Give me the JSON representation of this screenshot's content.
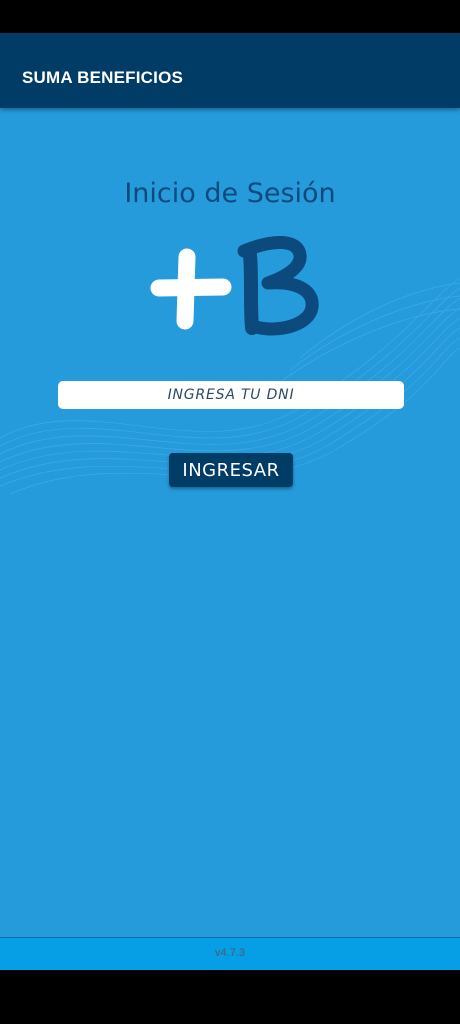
{
  "appbar": {
    "title": "SUMA BENEFICIOS"
  },
  "login": {
    "heading": "Inicio de Sesión",
    "dni_placeholder": "INGRESA TU DNI",
    "dni_value": "",
    "submit_label": "INGRESAR"
  },
  "logo": {
    "icon": "plus-b-logo"
  },
  "footer": {
    "version": "v4.7.3"
  },
  "colors": {
    "appbar": "#003c66",
    "background": "#259bdc",
    "heading": "#0e4a7e",
    "button": "#003c66",
    "footer": "#069ee4"
  }
}
